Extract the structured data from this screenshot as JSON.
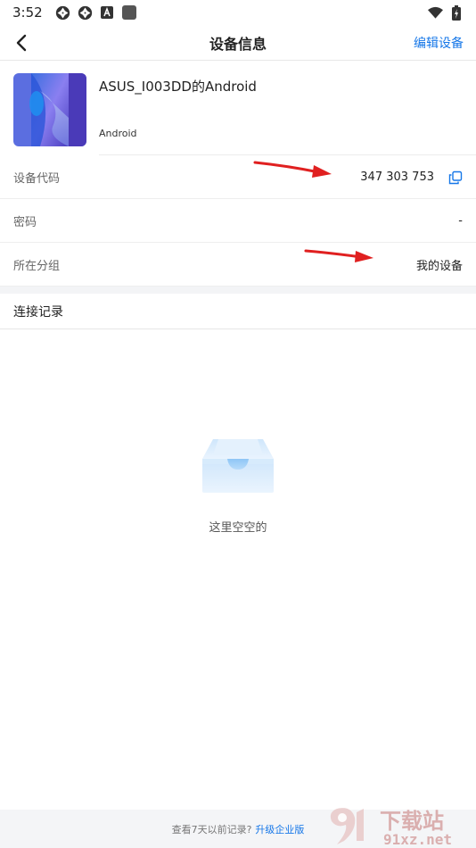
{
  "status_bar": {
    "time": "3:52",
    "left_icons": [
      "aperture-icon",
      "aperture-icon",
      "a-box-icon",
      "square-icon"
    ],
    "right_icons": [
      "wifi-icon",
      "battery-charging-icon"
    ]
  },
  "header": {
    "title": "设备信息",
    "edit_label": "编辑设备"
  },
  "device": {
    "name": "ASUS_I003DD的Android",
    "os": "Android"
  },
  "info_rows": [
    {
      "label": "设备代码",
      "value": "347 303 753"
    },
    {
      "label": "密码",
      "value": "-"
    },
    {
      "label": "所在分组",
      "value": "我的设备"
    }
  ],
  "section": {
    "title": "连接记录"
  },
  "empty_state": {
    "text": "这里空空的"
  },
  "footer": {
    "text": "查看7天以前记录?",
    "link": "升级企业版"
  },
  "watermark": {
    "brand": "下载站",
    "domain": "91xz.net"
  },
  "colors": {
    "accent": "#1677e8",
    "arrow": "#e02020"
  }
}
